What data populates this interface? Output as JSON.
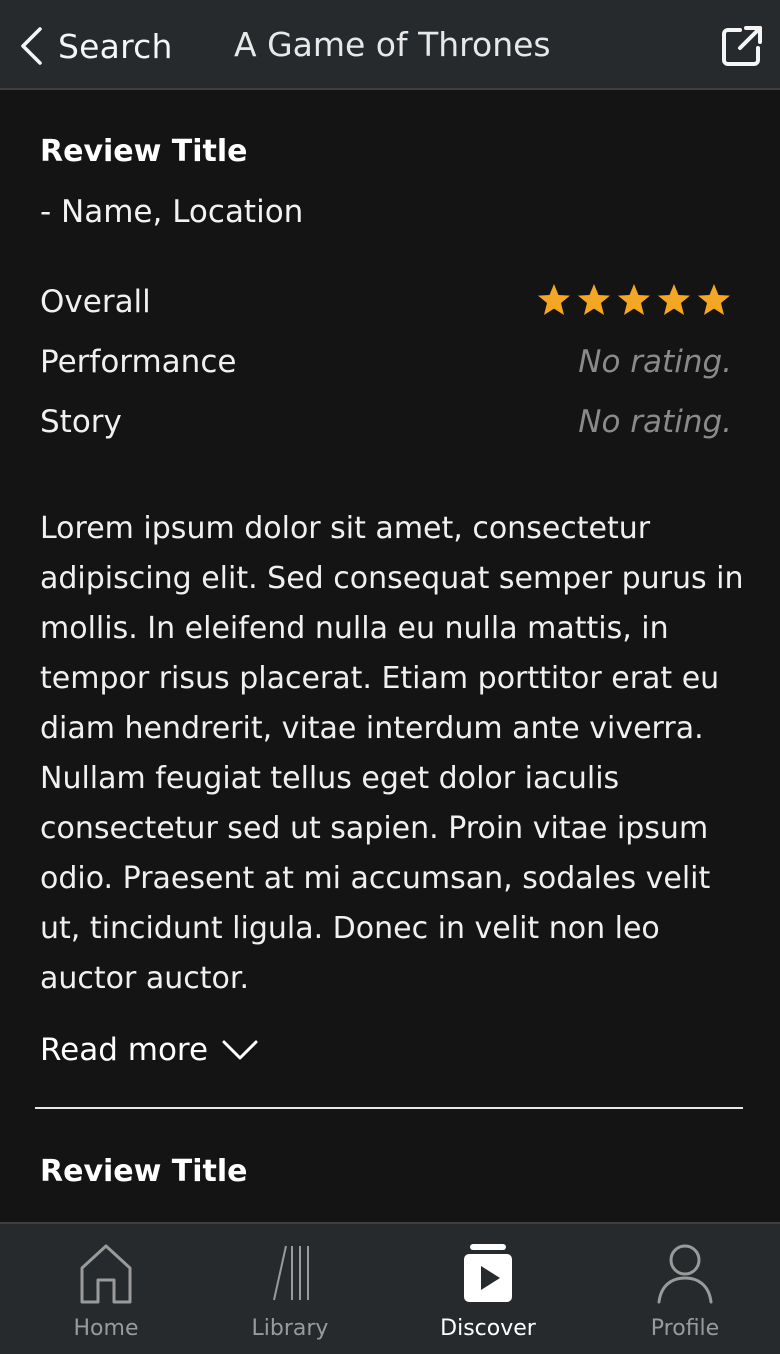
{
  "header": {
    "back_label": "Search",
    "title": "A Game of Thrones"
  },
  "reviews": [
    {
      "title": "Review Title",
      "author": "- Name, Location",
      "ratings": [
        {
          "label": "Overall",
          "stars": 5,
          "value": ""
        },
        {
          "label": "Performance",
          "stars": 0,
          "value": "No rating."
        },
        {
          "label": "Story",
          "stars": 0,
          "value": "No rating."
        }
      ],
      "body": "Lorem ipsum dolor sit amet, consectetur adipiscing elit. Sed consequat semper purus in mollis. In eleifend nulla eu nulla mattis, in tempor risus placerat. Etiam porttitor erat eu diam hendrerit, vitae interdum ante viverra. Nullam feugiat tellus eget dolor iaculis consectetur sed ut sapien. Proin vitae ipsum odio. Praesent at mi accumsan, sodales velit ut, tincidunt ligula. Donec in velit non leo auctor auctor.",
      "read_more": "Read more"
    },
    {
      "title": "Review Title"
    }
  ],
  "tabbar": {
    "items": [
      {
        "label": "Home",
        "icon": "home-icon"
      },
      {
        "label": "Library",
        "icon": "library-icon"
      },
      {
        "label": "Discover",
        "icon": "discover-icon",
        "active": true
      },
      {
        "label": "Profile",
        "icon": "profile-icon"
      }
    ]
  },
  "colors": {
    "background": "#141414",
    "bar_background": "#262a2c",
    "star": "#f5a623",
    "muted_text": "#8a8a8a",
    "inactive_tab": "#9a9a9a"
  }
}
